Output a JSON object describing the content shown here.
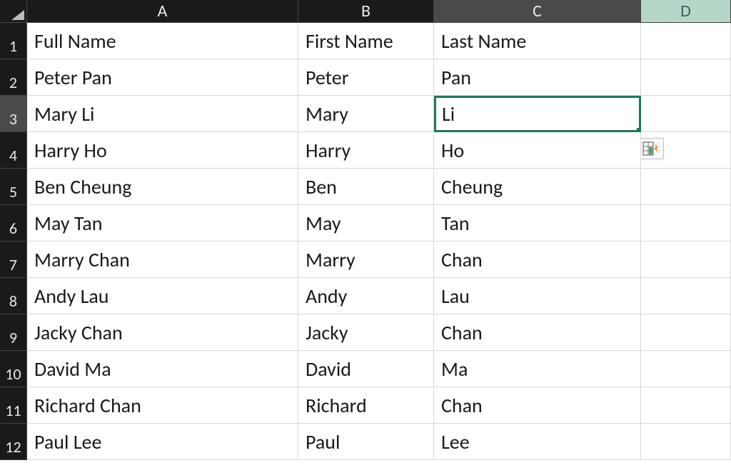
{
  "columns": [
    "A",
    "B",
    "C",
    "D"
  ],
  "selected_column_index": 2,
  "selected_row_index": 2,
  "active_cell": {
    "row": 2,
    "col": 2
  },
  "rows": [
    {
      "A": "Full Name",
      "B": "First Name",
      "C": "Last Name"
    },
    {
      "A": "Peter Pan",
      "B": "Peter",
      "C": "Pan"
    },
    {
      "A": "Mary Li",
      "B": "Mary",
      "C": "Li"
    },
    {
      "A": "Harry Ho",
      "B": "Harry",
      "C": "Ho"
    },
    {
      "A": "Ben Cheung",
      "B": "Ben",
      "C": "Cheung"
    },
    {
      "A": "May Tan",
      "B": "May",
      "C": "Tan"
    },
    {
      "A": "Marry Chan",
      "B": "Marry",
      "C": "Chan"
    },
    {
      "A": "Andy Lau",
      "B": "Andy",
      "C": "Lau"
    },
    {
      "A": "Jacky Chan",
      "B": "Jacky",
      "C": "Chan"
    },
    {
      "A": "David Ma",
      "B": "David",
      "C": "Ma"
    },
    {
      "A": "Richard Chan",
      "B": "Richard",
      "C": "Chan"
    },
    {
      "A": "Paul Lee",
      "B": "Paul",
      "C": "Lee"
    }
  ],
  "flash_fill_button": {
    "row": 3,
    "after_col": 2
  },
  "colors": {
    "active_border": "#1e7a55",
    "header_bg": "#1a1a1a",
    "header_selected_bg": "#4a4a4a",
    "col_d_bg": "#b6d7c8"
  }
}
